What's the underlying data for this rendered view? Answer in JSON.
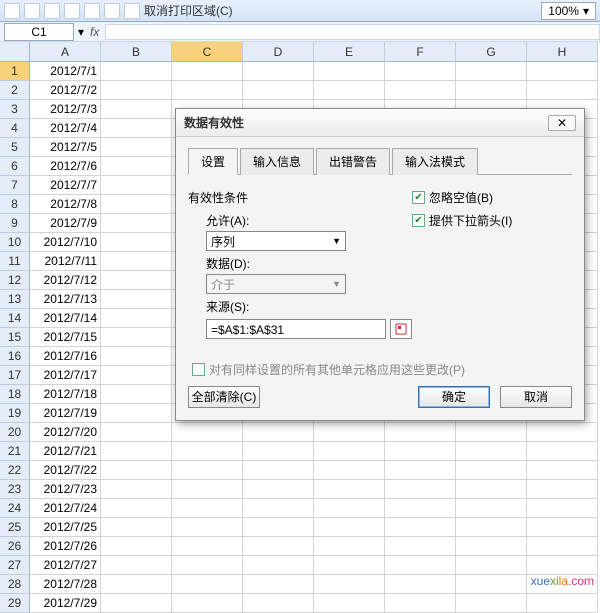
{
  "toolbar": {
    "print_area_label": "取消打印区域(C)",
    "zoom": "100%"
  },
  "namebox": {
    "ref": "C1",
    "fx": "fx"
  },
  "columns": [
    "A",
    "B",
    "C",
    "D",
    "E",
    "F",
    "G",
    "H"
  ],
  "rows": [
    {
      "n": "1",
      "a": "2012/7/1"
    },
    {
      "n": "2",
      "a": "2012/7/2"
    },
    {
      "n": "3",
      "a": "2012/7/3"
    },
    {
      "n": "4",
      "a": "2012/7/4"
    },
    {
      "n": "5",
      "a": "2012/7/5"
    },
    {
      "n": "6",
      "a": "2012/7/6"
    },
    {
      "n": "7",
      "a": "2012/7/7"
    },
    {
      "n": "8",
      "a": "2012/7/8"
    },
    {
      "n": "9",
      "a": "2012/7/9"
    },
    {
      "n": "10",
      "a": "2012/7/10"
    },
    {
      "n": "11",
      "a": "2012/7/11"
    },
    {
      "n": "12",
      "a": "2012/7/12"
    },
    {
      "n": "13",
      "a": "2012/7/13"
    },
    {
      "n": "14",
      "a": "2012/7/14"
    },
    {
      "n": "15",
      "a": "2012/7/15"
    },
    {
      "n": "16",
      "a": "2012/7/16"
    },
    {
      "n": "17",
      "a": "2012/7/17"
    },
    {
      "n": "18",
      "a": "2012/7/18"
    },
    {
      "n": "19",
      "a": "2012/7/19"
    },
    {
      "n": "20",
      "a": "2012/7/20"
    },
    {
      "n": "21",
      "a": "2012/7/21"
    },
    {
      "n": "22",
      "a": "2012/7/22"
    },
    {
      "n": "23",
      "a": "2012/7/23"
    },
    {
      "n": "24",
      "a": "2012/7/24"
    },
    {
      "n": "25",
      "a": "2012/7/25"
    },
    {
      "n": "26",
      "a": "2012/7/26"
    },
    {
      "n": "27",
      "a": "2012/7/27"
    },
    {
      "n": "28",
      "a": "2012/7/28"
    },
    {
      "n": "29",
      "a": "2012/7/29"
    }
  ],
  "dialog": {
    "title": "数据有效性",
    "close": "✕",
    "tabs": [
      "设置",
      "输入信息",
      "出错警告",
      "输入法模式"
    ],
    "group": "有效性条件",
    "allow_label": "允许(A):",
    "allow_value": "序列",
    "data_label": "数据(D):",
    "data_value": "介于",
    "source_label": "来源(S):",
    "source_value": "=$A$1:$A$31",
    "chk_ignore": "忽略空值(B)",
    "chk_dropdown": "提供下拉箭头(I)",
    "apply_label": "对有同样设置的所有其他单元格应用这些更改(P)",
    "btn_clear": "全部清除(C)",
    "btn_ok": "确定",
    "btn_cancel": "取消"
  },
  "watermark": {
    "text": "xuexila.com"
  }
}
